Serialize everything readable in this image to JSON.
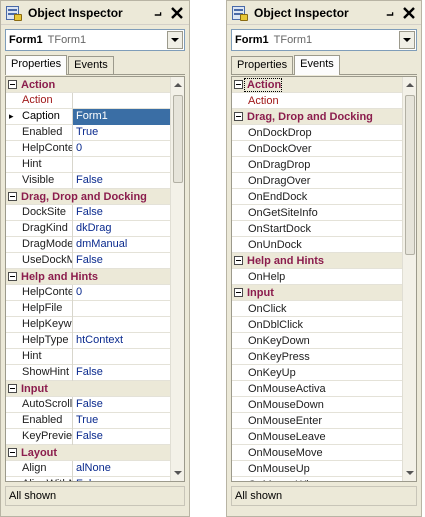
{
  "left": {
    "title": "Object Inspector",
    "pin_glyph": "⨼",
    "combo": {
      "name": "Form1",
      "type": "TForm1"
    },
    "tabs": [
      {
        "label": "Properties",
        "active": true
      },
      {
        "label": "Events",
        "active": false
      }
    ],
    "rows": [
      {
        "kind": "cat",
        "label": "Action"
      },
      {
        "kind": "prop",
        "name": "Action",
        "value": "",
        "red": true
      },
      {
        "kind": "prop",
        "name": "Caption",
        "value": "Form1",
        "selected": true
      },
      {
        "kind": "prop",
        "name": "Enabled",
        "value": "True"
      },
      {
        "kind": "prop",
        "name": "HelpConte",
        "value": "0"
      },
      {
        "kind": "prop",
        "name": "Hint",
        "value": ""
      },
      {
        "kind": "prop",
        "name": "Visible",
        "value": "False"
      },
      {
        "kind": "cat",
        "label": "Drag, Drop and Docking"
      },
      {
        "kind": "prop",
        "name": "DockSite",
        "value": "False"
      },
      {
        "kind": "prop",
        "name": "DragKind",
        "value": "dkDrag"
      },
      {
        "kind": "prop",
        "name": "DragMode",
        "value": "dmManual"
      },
      {
        "kind": "prop",
        "name": "UseDockMa",
        "value": "False"
      },
      {
        "kind": "cat",
        "label": "Help and Hints"
      },
      {
        "kind": "prop",
        "name": "HelpConte",
        "value": "0"
      },
      {
        "kind": "prop",
        "name": "HelpFile",
        "value": ""
      },
      {
        "kind": "prop",
        "name": "HelpKeywo",
        "value": ""
      },
      {
        "kind": "prop",
        "name": "HelpType",
        "value": "htContext"
      },
      {
        "kind": "prop",
        "name": "Hint",
        "value": ""
      },
      {
        "kind": "prop",
        "name": "ShowHint",
        "value": "False"
      },
      {
        "kind": "cat",
        "label": "Input"
      },
      {
        "kind": "prop",
        "name": "AutoScroll",
        "value": "False"
      },
      {
        "kind": "prop",
        "name": "Enabled",
        "value": "True"
      },
      {
        "kind": "prop",
        "name": "KeyPreview",
        "value": "False"
      },
      {
        "kind": "cat",
        "label": "Layout"
      },
      {
        "kind": "prop",
        "name": "Align",
        "value": "alNone"
      },
      {
        "kind": "prop",
        "name": "AlignWithM",
        "value": "False"
      }
    ],
    "status": "All shown"
  },
  "right": {
    "title": "Object Inspector",
    "pin_glyph": "⨼",
    "combo": {
      "name": "Form1",
      "type": "TForm1"
    },
    "tabs": [
      {
        "label": "Properties",
        "active": false
      },
      {
        "label": "Events",
        "active": true
      }
    ],
    "rows": [
      {
        "kind": "cat",
        "label": "Action",
        "focus": true
      },
      {
        "kind": "ev",
        "name": "Action",
        "red": true
      },
      {
        "kind": "cat",
        "label": "Drag, Drop and Docking"
      },
      {
        "kind": "ev",
        "name": "OnDockDrop"
      },
      {
        "kind": "ev",
        "name": "OnDockOver"
      },
      {
        "kind": "ev",
        "name": "OnDragDrop"
      },
      {
        "kind": "ev",
        "name": "OnDragOver"
      },
      {
        "kind": "ev",
        "name": "OnEndDock"
      },
      {
        "kind": "ev",
        "name": "OnGetSiteInfo"
      },
      {
        "kind": "ev",
        "name": "OnStartDock"
      },
      {
        "kind": "ev",
        "name": "OnUnDock"
      },
      {
        "kind": "cat",
        "label": "Help and Hints"
      },
      {
        "kind": "ev",
        "name": "OnHelp"
      },
      {
        "kind": "cat",
        "label": "Input"
      },
      {
        "kind": "ev",
        "name": "OnClick"
      },
      {
        "kind": "ev",
        "name": "OnDblClick"
      },
      {
        "kind": "ev",
        "name": "OnKeyDown"
      },
      {
        "kind": "ev",
        "name": "OnKeyPress"
      },
      {
        "kind": "ev",
        "name": "OnKeyUp"
      },
      {
        "kind": "ev",
        "name": "OnMouseActiva"
      },
      {
        "kind": "ev",
        "name": "OnMouseDown"
      },
      {
        "kind": "ev",
        "name": "OnMouseEnter"
      },
      {
        "kind": "ev",
        "name": "OnMouseLeave"
      },
      {
        "kind": "ev",
        "name": "OnMouseMove"
      },
      {
        "kind": "ev",
        "name": "OnMouseUp"
      },
      {
        "kind": "ev",
        "name": "OnMouseWhee"
      }
    ],
    "status": "All shown"
  }
}
